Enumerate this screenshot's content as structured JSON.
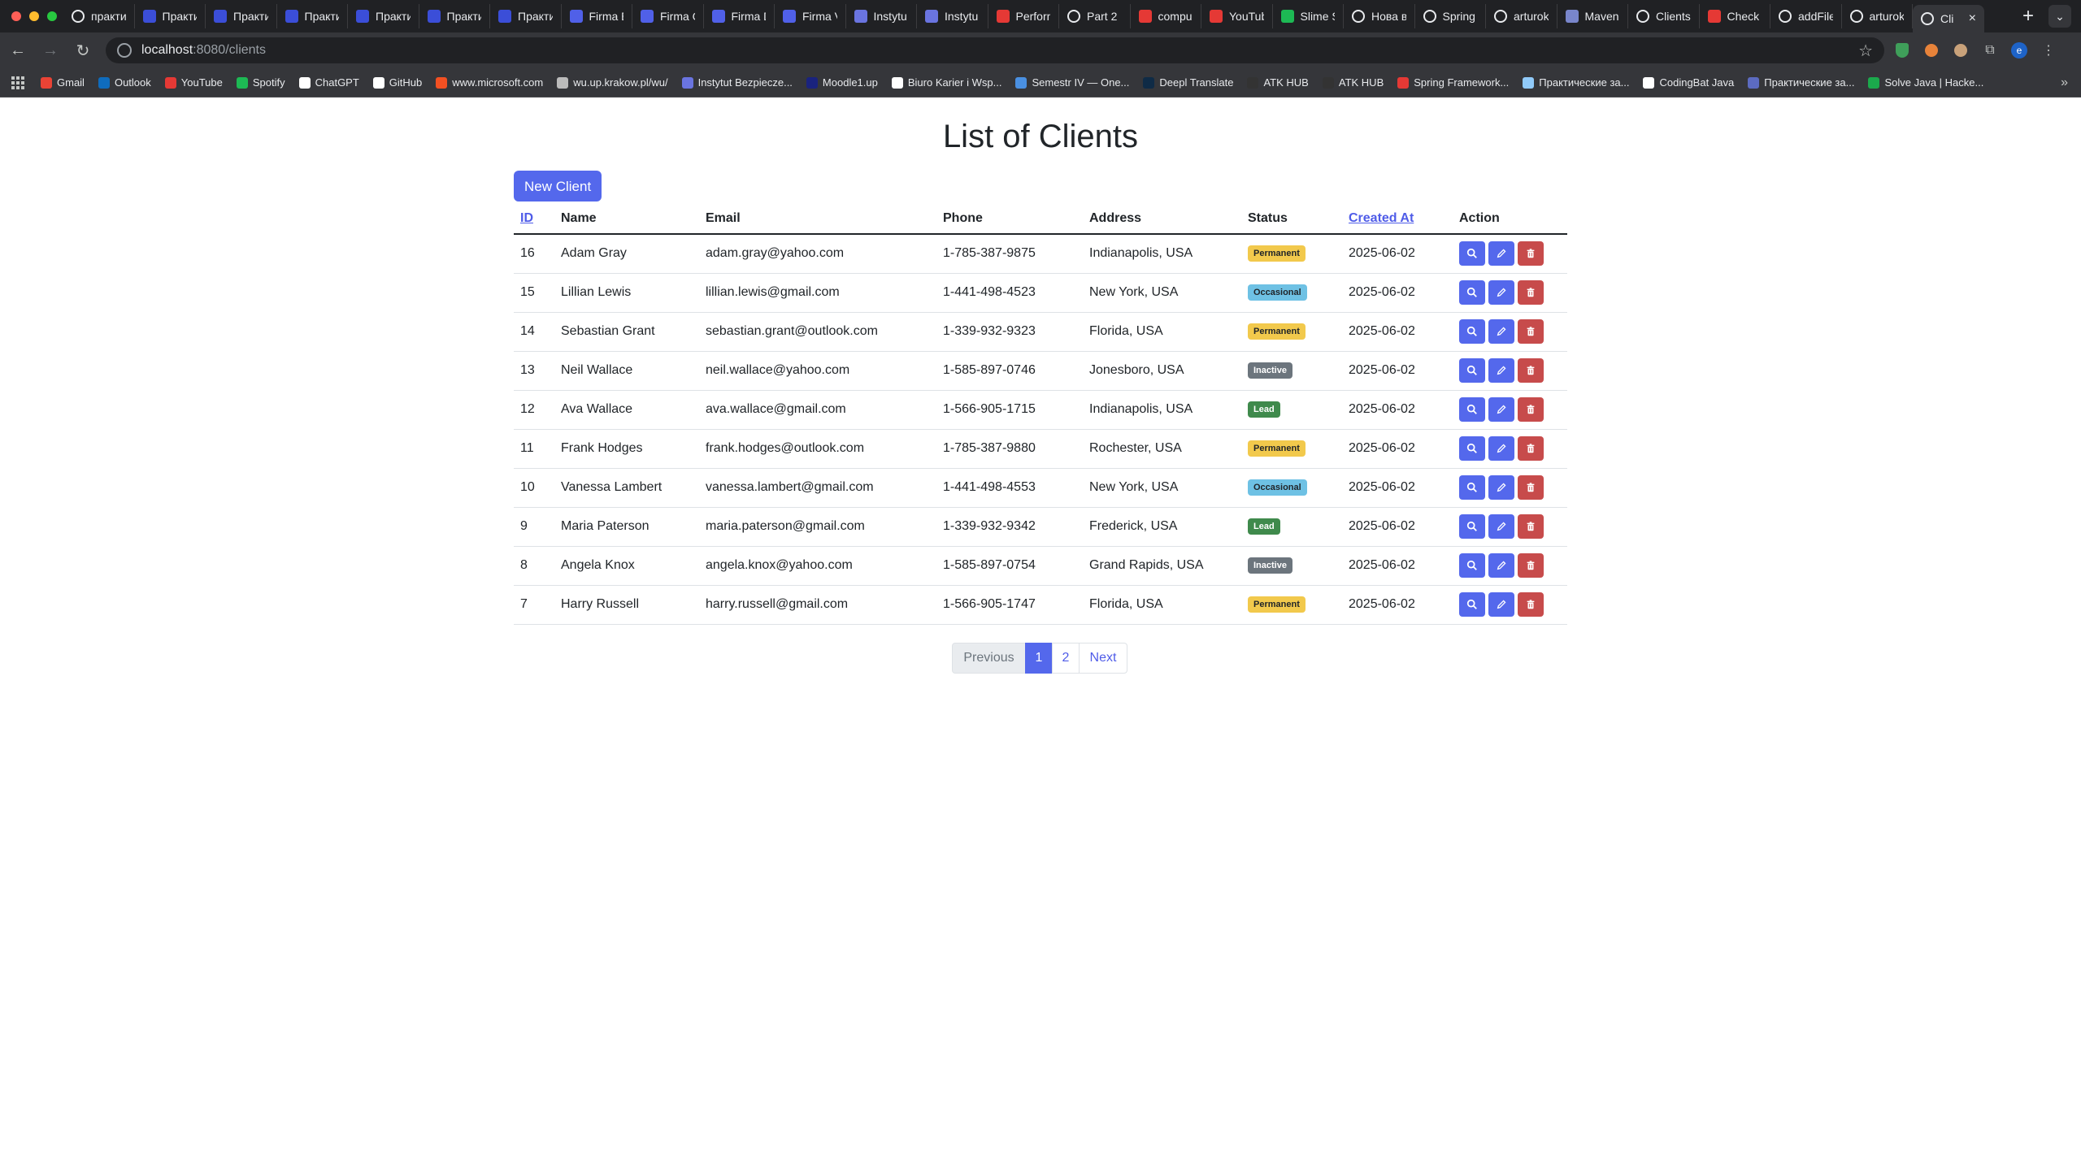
{
  "browser": {
    "tabs": [
      {
        "title": "практи",
        "icon": "google-icon",
        "color": "#ffffff"
      },
      {
        "title": "Практи",
        "icon": "f-icon",
        "color": "#3b4ed8"
      },
      {
        "title": "Практи",
        "icon": "f-icon",
        "color": "#3b4ed8"
      },
      {
        "title": "Практи",
        "icon": "f-icon",
        "color": "#3b4ed8"
      },
      {
        "title": "Практи",
        "icon": "f-icon",
        "color": "#3b4ed8"
      },
      {
        "title": "Практи",
        "icon": "f-icon",
        "color": "#3b4ed8"
      },
      {
        "title": "Практи",
        "icon": "f-icon",
        "color": "#3b4ed8"
      },
      {
        "title": "Firma E",
        "icon": "a-icon",
        "color": "#5060e8"
      },
      {
        "title": "Firma C",
        "icon": "a-icon",
        "color": "#5060e8"
      },
      {
        "title": "Firma D",
        "icon": "a-icon",
        "color": "#5060e8"
      },
      {
        "title": "Firma V",
        "icon": "a-icon",
        "color": "#5060e8"
      },
      {
        "title": "Instytu",
        "icon": "s-icon",
        "color": "#6a74e0"
      },
      {
        "title": "Instytu",
        "icon": "s-icon",
        "color": "#6a74e0"
      },
      {
        "title": "Perforn",
        "icon": "youtube-icon",
        "color": "#e53935"
      },
      {
        "title": "Part 2",
        "icon": "p-icon",
        "color": "#ffffff"
      },
      {
        "title": "compu",
        "icon": "youtube-icon",
        "color": "#e53935"
      },
      {
        "title": "YouTub",
        "icon": "youtube-icon",
        "color": "#e53935"
      },
      {
        "title": "Slime S",
        "icon": "spotify-icon",
        "color": "#1db954"
      },
      {
        "title": "Нова в",
        "icon": "globe-icon",
        "color": "#ffffff"
      },
      {
        "title": "Spring",
        "icon": "globe-icon",
        "color": "#ffffff"
      },
      {
        "title": "arturok",
        "icon": "github-icon",
        "color": "#ffffff"
      },
      {
        "title": "Maven",
        "icon": "m-icon",
        "color": "#7986cb"
      },
      {
        "title": "Clients",
        "icon": "globe-icon",
        "color": "#ffffff"
      },
      {
        "title": "Check",
        "icon": "youtube-icon",
        "color": "#e53935"
      },
      {
        "title": "addFile",
        "icon": "globe-icon",
        "color": "#ffffff"
      },
      {
        "title": "arturok",
        "icon": "github-icon",
        "color": "#ffffff"
      },
      {
        "title": "Cli",
        "icon": "globe-icon",
        "color": "#ffffff",
        "active": true
      }
    ],
    "url_host": "localhost",
    "url_path": ":8080/clients",
    "bookmarks": [
      {
        "label": "Gmail",
        "color": "#ea4335"
      },
      {
        "label": "Outlook",
        "color": "#0f6cbd"
      },
      {
        "label": "YouTube",
        "color": "#e53935"
      },
      {
        "label": "Spotify",
        "color": "#1db954"
      },
      {
        "label": "ChatGPT",
        "color": "#ffffff"
      },
      {
        "label": "GitHub",
        "color": "#ffffff"
      },
      {
        "label": "www.microsoft.com",
        "color": "#f25022"
      },
      {
        "label": "wu.up.krakow.pl/wu/",
        "color": "#bbbbbb"
      },
      {
        "label": "Instytut Bezpiecze...",
        "color": "#6a74e0"
      },
      {
        "label": "Moodle1.up",
        "color": "#1a237e"
      },
      {
        "label": "Biuro Karier i Wsp...",
        "color": "#ffffff"
      },
      {
        "label": "Semestr IV — One...",
        "color": "#4a90e2"
      },
      {
        "label": "Deepl Translate",
        "color": "#0f2b46"
      },
      {
        "label": "ATK HUB",
        "color": "#333333"
      },
      {
        "label": "ATK HUB",
        "color": "#333333"
      },
      {
        "label": "Spring Framework...",
        "color": "#e53935"
      },
      {
        "label": "Практические за...",
        "color": "#90caf9"
      },
      {
        "label": "CodingBat Java",
        "color": "#ffffff"
      },
      {
        "label": "Практические за...",
        "color": "#5c6bc0"
      },
      {
        "label": "Solve Java | Hacke...",
        "color": "#1ba94c"
      }
    ]
  },
  "page": {
    "title": "List of Clients",
    "new_client_label": "New Client"
  },
  "table": {
    "headers": {
      "id": "ID",
      "name": "Name",
      "email": "Email",
      "phone": "Phone",
      "address": "Address",
      "status": "Status",
      "created_at": "Created At",
      "action": "Action"
    },
    "rows": [
      {
        "id": "16",
        "name": "Adam Gray",
        "email": "adam.gray@yahoo.com",
        "phone": "1-785-387-9875",
        "address": "Indianapolis, USA",
        "status": "Permanent",
        "created_at": "2025-06-02"
      },
      {
        "id": "15",
        "name": "Lillian Lewis",
        "email": "lillian.lewis@gmail.com",
        "phone": "1-441-498-4523",
        "address": "New York, USA",
        "status": "Occasional",
        "created_at": "2025-06-02"
      },
      {
        "id": "14",
        "name": "Sebastian Grant",
        "email": "sebastian.grant@outlook.com",
        "phone": "1-339-932-9323",
        "address": "Florida, USA",
        "status": "Permanent",
        "created_at": "2025-06-02"
      },
      {
        "id": "13",
        "name": "Neil Wallace",
        "email": "neil.wallace@yahoo.com",
        "phone": "1-585-897-0746",
        "address": "Jonesboro, USA",
        "status": "Inactive",
        "created_at": "2025-06-02"
      },
      {
        "id": "12",
        "name": "Ava Wallace",
        "email": "ava.wallace@gmail.com",
        "phone": "1-566-905-1715",
        "address": "Indianapolis, USA",
        "status": "Lead",
        "created_at": "2025-06-02"
      },
      {
        "id": "11",
        "name": "Frank Hodges",
        "email": "frank.hodges@outlook.com",
        "phone": "1-785-387-9880",
        "address": "Rochester, USA",
        "status": "Permanent",
        "created_at": "2025-06-02"
      },
      {
        "id": "10",
        "name": "Vanessa Lambert",
        "email": "vanessa.lambert@gmail.com",
        "phone": "1-441-498-4553",
        "address": "New York, USA",
        "status": "Occasional",
        "created_at": "2025-06-02"
      },
      {
        "id": "9",
        "name": "Maria Paterson",
        "email": "maria.paterson@gmail.com",
        "phone": "1-339-932-9342",
        "address": "Frederick, USA",
        "status": "Lead",
        "created_at": "2025-06-02"
      },
      {
        "id": "8",
        "name": "Angela Knox",
        "email": "angela.knox@yahoo.com",
        "phone": "1-585-897-0754",
        "address": "Grand Rapids, USA",
        "status": "Inactive",
        "created_at": "2025-06-02"
      },
      {
        "id": "7",
        "name": "Harry Russell",
        "email": "harry.russell@gmail.com",
        "phone": "1-566-905-1747",
        "address": "Florida, USA",
        "status": "Permanent",
        "created_at": "2025-06-02"
      }
    ]
  },
  "pagination": {
    "previous": "Previous",
    "pages": [
      "1",
      "2"
    ],
    "current": "1",
    "next": "Next"
  },
  "colors": {
    "primary": "#5468ec",
    "danger": "#c74b4b",
    "permanent": "#f2c94c",
    "occasional": "#6ec1e4",
    "inactive": "#6c757d",
    "lead": "#3f8a4c"
  }
}
